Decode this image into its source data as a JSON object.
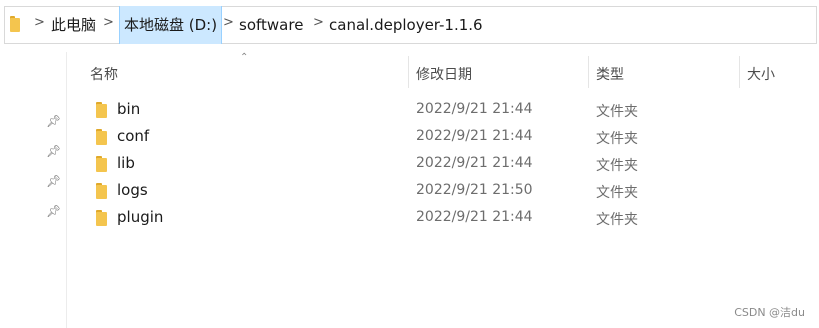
{
  "breadcrumb": {
    "items": [
      "此电脑",
      "本地磁盘 (D:)",
      "software",
      "canal.deployer-1.1.6"
    ],
    "separator": ">",
    "active_index": 1
  },
  "columns": {
    "name": "名称",
    "date": "修改日期",
    "type": "类型",
    "size": "大小"
  },
  "files": [
    {
      "name": "bin",
      "date": "2022/9/21 21:44",
      "type": "文件夹"
    },
    {
      "name": "conf",
      "date": "2022/9/21 21:44",
      "type": "文件夹"
    },
    {
      "name": "lib",
      "date": "2022/9/21 21:44",
      "type": "文件夹"
    },
    {
      "name": "logs",
      "date": "2022/9/21 21:50",
      "type": "文件夹"
    },
    {
      "name": "plugin",
      "date": "2022/9/21 21:44",
      "type": "文件夹"
    }
  ],
  "pins": [
    "pin-icon",
    "pin-icon",
    "pin-icon",
    "pin-icon"
  ],
  "watermark": "CSDN @洁du",
  "colors": {
    "folder": "#f4c54e",
    "selected_crumb": "#cce8ff"
  }
}
